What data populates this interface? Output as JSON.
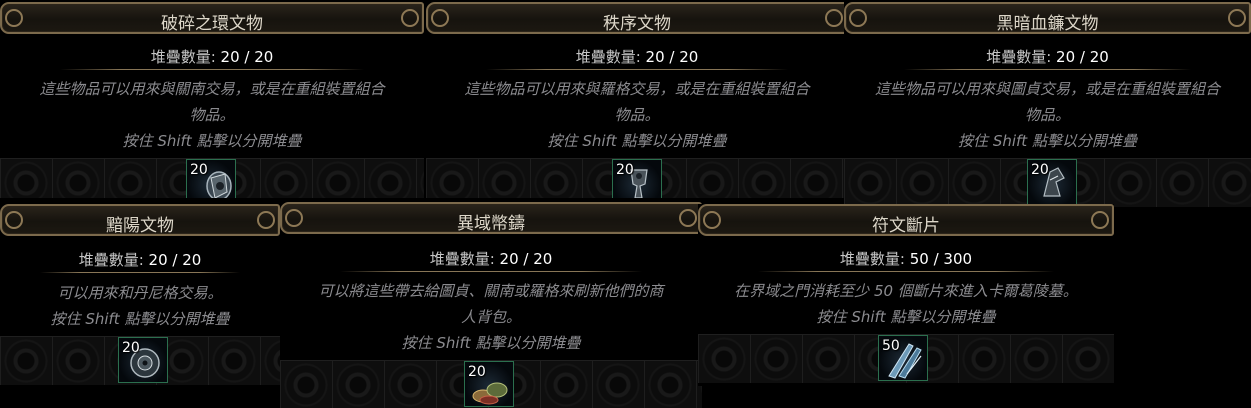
{
  "tooltips": [
    {
      "title": "破碎之環文物",
      "stack_label": "堆疊數量: ",
      "stack_value": "20 / 20",
      "desc_lines": [
        "這些物品可以用來與關南交易，或是在重組裝置組合",
        "物品。"
      ],
      "hint": "按住 Shift 點擊以分開堆疊",
      "quantity": "20",
      "icon": "shattered-ring-artifact-icon"
    },
    {
      "title": "秩序文物",
      "stack_label": "堆疊數量: ",
      "stack_value": "20 / 20",
      "desc_lines": [
        "這些物品可以用來與羅格交易，或是在重組裝置組合",
        "物品。"
      ],
      "hint": "按住 Shift 點擊以分開堆疊",
      "quantity": "20",
      "icon": "order-artifact-icon"
    },
    {
      "title": "黑暗血鐮文物",
      "stack_label": "堆疊數量: ",
      "stack_value": "20 / 20",
      "desc_lines": [
        "這些物品可以用來與圖貞交易，或是在重組裝置組合",
        "物品。"
      ],
      "hint": "按住 Shift 點擊以分開堆疊",
      "quantity": "20",
      "icon": "black-scythe-artifact-icon"
    },
    {
      "title": "黯陽文物",
      "stack_label": "堆疊數量: ",
      "stack_value": "20 / 20",
      "desc_lines": [
        "可以用來和丹尼格交易。"
      ],
      "hint": "按住 Shift 點擊以分開堆疊",
      "quantity": "20",
      "icon": "sun-artifact-icon"
    },
    {
      "title": "異域幣鑄",
      "stack_label": "堆疊數量: ",
      "stack_value": "20 / 20",
      "desc_lines": [
        "可以將這些帶去給圖貞、關南或羅格來刷新他們的商",
        "人背包。"
      ],
      "hint": "按住 Shift 點擊以分開堆疊",
      "quantity": "20",
      "icon": "exotic-coinage-icon"
    },
    {
      "title": "符文斷片",
      "stack_label": "堆疊數量: ",
      "stack_value": "50 / 300",
      "desc_lines": [
        "在界域之門消耗至少 50 個斷片來進入卡爾葛陵墓。"
      ],
      "hint": "按住 Shift 點擊以分開堆疊",
      "quantity": "50",
      "icon": "rune-shard-icon"
    }
  ],
  "colors": {
    "header_border": "#7c6a4c",
    "title_text": "#ddd7c9",
    "description_text": "#8b8b8f",
    "value_text": "#ffffff",
    "slot_border": "#2b6f4e"
  }
}
